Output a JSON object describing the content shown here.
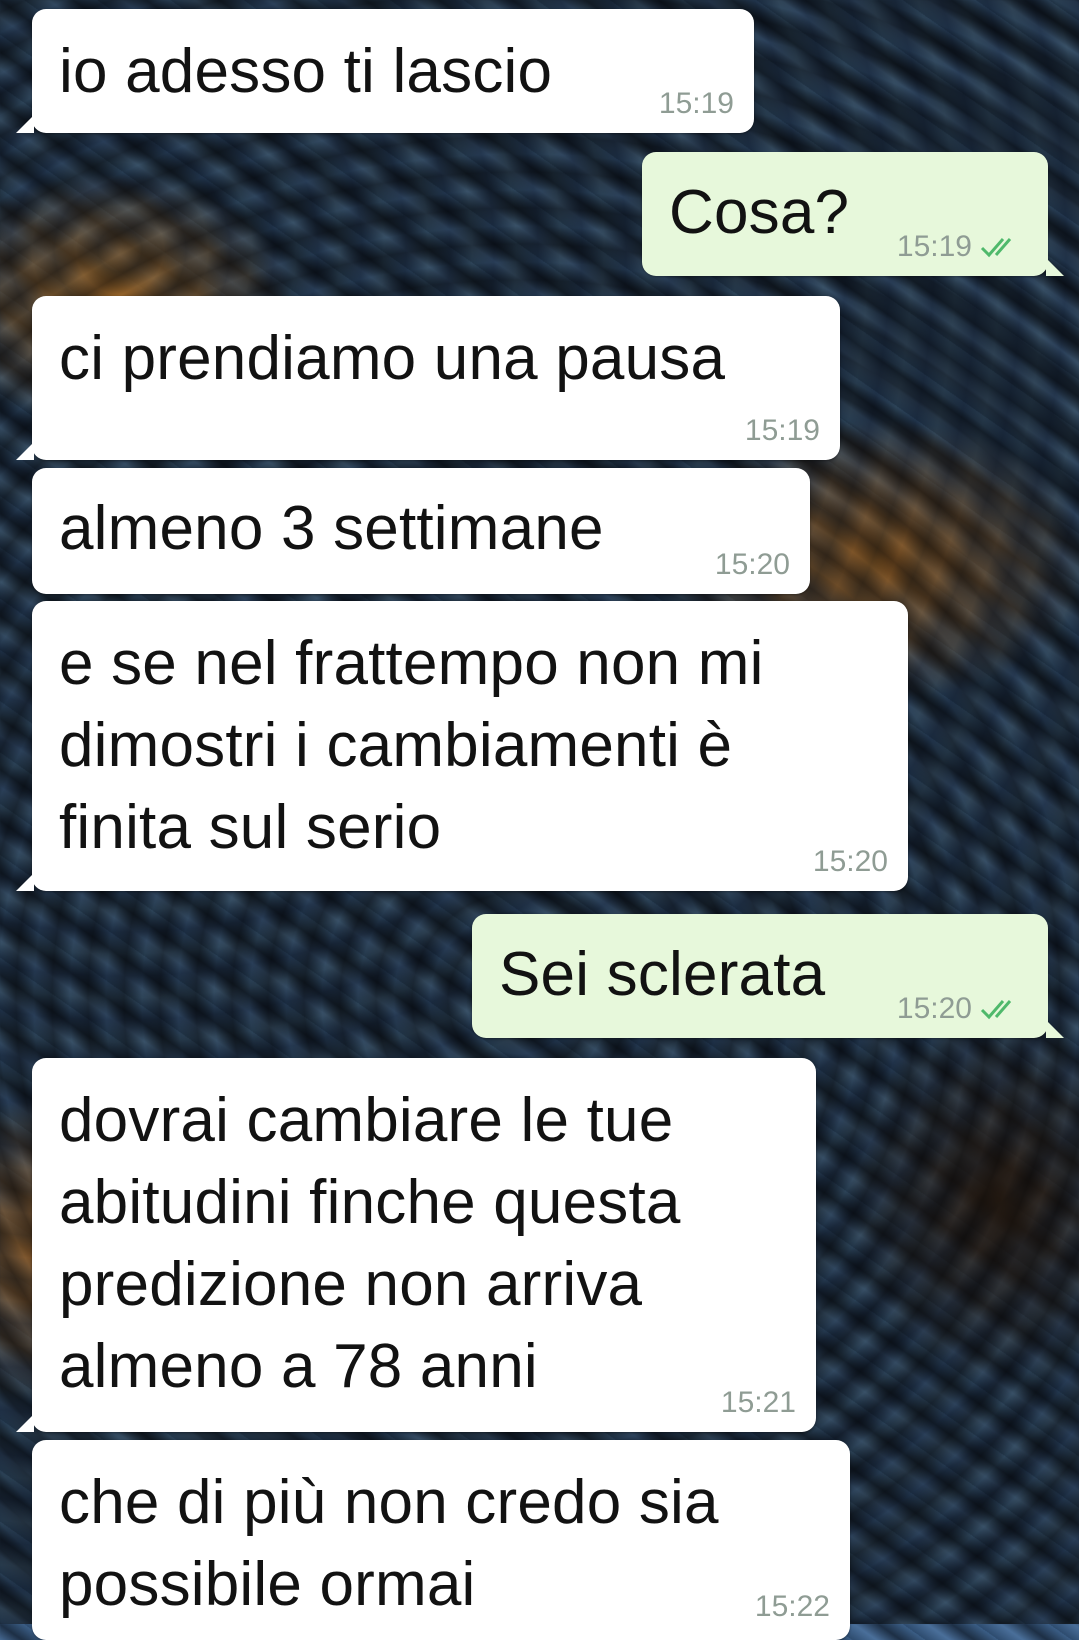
{
  "messages": [
    {
      "direction": "incoming",
      "text": "io adesso ti lascio",
      "time": "15:19"
    },
    {
      "direction": "outgoing",
      "text": "Cosa?",
      "time": "15:19",
      "status": "double-check-read"
    },
    {
      "direction": "incoming",
      "text": "ci prendiamo una pausa",
      "time": "15:19"
    },
    {
      "direction": "incoming",
      "text": "almeno 3 settimane",
      "time": "15:20"
    },
    {
      "direction": "incoming",
      "text": "e se nel frattempo non mi\ndimostri i cambiamenti è\nfinita sul serio",
      "time": "15:20"
    },
    {
      "direction": "outgoing",
      "text": "Sei sclerata",
      "time": "15:20",
      "status": "double-check-read"
    },
    {
      "direction": "incoming",
      "text": "dovrai cambiare le tue\nabitudini finche questa\npredizione non arriva\nalmeno a 78 anni",
      "time": "15:21"
    },
    {
      "direction": "incoming",
      "text": "che di più non credo sia\npossibile ormai",
      "time": "15:22"
    }
  ],
  "colors": {
    "incoming_bubble": "#ffffff",
    "outgoing_bubble": "#e7f8db",
    "timestamp": "#8f9c94",
    "read_ticks": "#4fb96b"
  },
  "icons": {
    "read_receipt": "double-check-icon"
  }
}
